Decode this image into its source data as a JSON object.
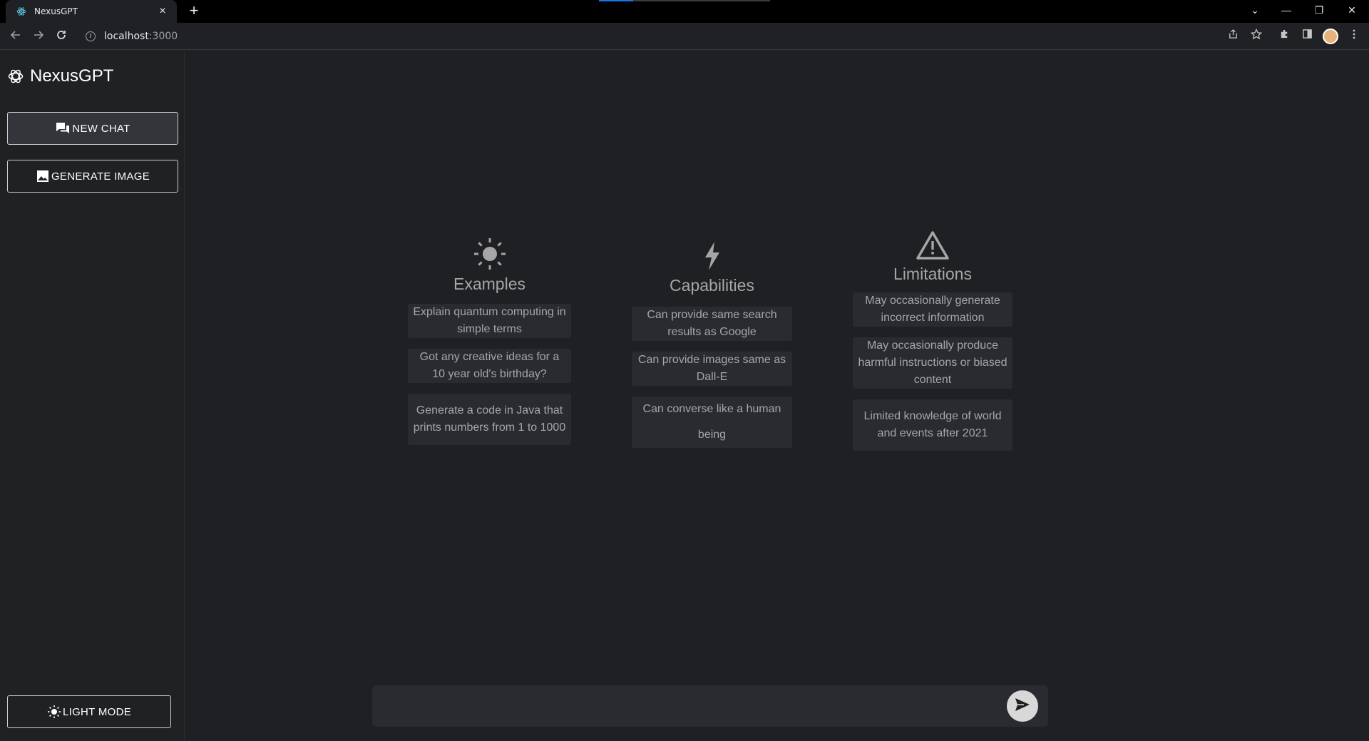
{
  "browser": {
    "tab_title": "NexusGPT",
    "tab_close": "×",
    "new_tab": "+",
    "url_host": "localhost",
    "url_port": ":3000",
    "controls": {
      "chevron": "⌄",
      "minimize": "—",
      "restore": "❐",
      "close": "✕"
    }
  },
  "sidebar": {
    "brand": "NexusGPT",
    "new_chat_label": "NEW CHAT",
    "generate_image_label": "GENERATE IMAGE",
    "light_mode_label": "LIGHT MODE"
  },
  "columns": {
    "examples": {
      "title": "Examples",
      "icon": "sun-icon",
      "items": [
        "Explain quantum computing in simple terms",
        "Got any creative ideas for a 10 year old's birthday?",
        "Generate a code in Java that prints numbers from 1 to 1000"
      ]
    },
    "capabilities": {
      "title": "Capabilities",
      "icon": "bolt-icon",
      "items": [
        "Can provide same search results as Google",
        "Can provide images same as Dall-E",
        "Can converse like a human being"
      ]
    },
    "limitations": {
      "title": "Limitations",
      "icon": "warning-icon",
      "items": [
        "May occasionally generate incorrect information",
        "May occasionally produce harmful instructions or biased content",
        "Limited knowledge of world and events after 2021"
      ]
    }
  },
  "composer": {
    "value": "",
    "placeholder": ""
  },
  "colors": {
    "background": "#1f2023",
    "sidebar": "#202123",
    "card": "#2a2b30",
    "muted_text": "#a6a6a6"
  }
}
